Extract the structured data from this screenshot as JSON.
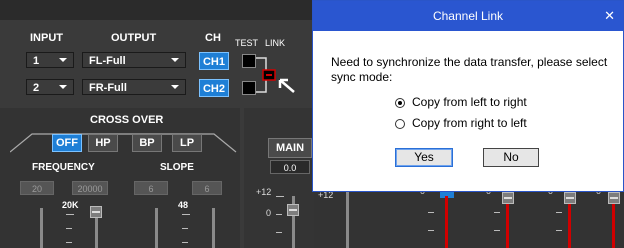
{
  "routing": {
    "headers": {
      "input": "INPUT",
      "output": "OUTPUT",
      "ch": "CH",
      "test": "TEST",
      "link": "LINK"
    },
    "rows": [
      {
        "input": "1",
        "output": "FL-Full",
        "ch": "CH1"
      },
      {
        "input": "2",
        "output": "FR-Full",
        "ch": "CH2"
      }
    ]
  },
  "crossover": {
    "title": "CROSS OVER",
    "buttons": [
      "OFF",
      "HP",
      "BP",
      "LP"
    ],
    "active": "OFF",
    "frequency_label": "FREQUENCY",
    "slope_label": "SLOPE",
    "freq_values": [
      "20",
      "20000"
    ],
    "slope_values": [
      "6",
      "6"
    ],
    "fader_freq_label": "20K",
    "fader_slope_label": "48"
  },
  "main": {
    "label": "MAIN",
    "value": "0.0",
    "scale_top": "+12",
    "scale_mid": "0",
    "scale_top_2": "+12"
  },
  "channel_faders": {
    "scale": [
      "0",
      "0",
      "0",
      "0"
    ]
  },
  "dialog": {
    "title": "Channel Link",
    "close": "✕",
    "message": "Need to synchronize the data transfer, please select sync mode:",
    "options": [
      "Copy from left to right",
      "Copy from right to left"
    ],
    "selected_index": 0,
    "yes": "Yes",
    "no": "No"
  },
  "colors": {
    "accent_blue": "#1e7fd6",
    "dialog_title_bar": "#2a56d0",
    "link_red": "#d10000"
  }
}
